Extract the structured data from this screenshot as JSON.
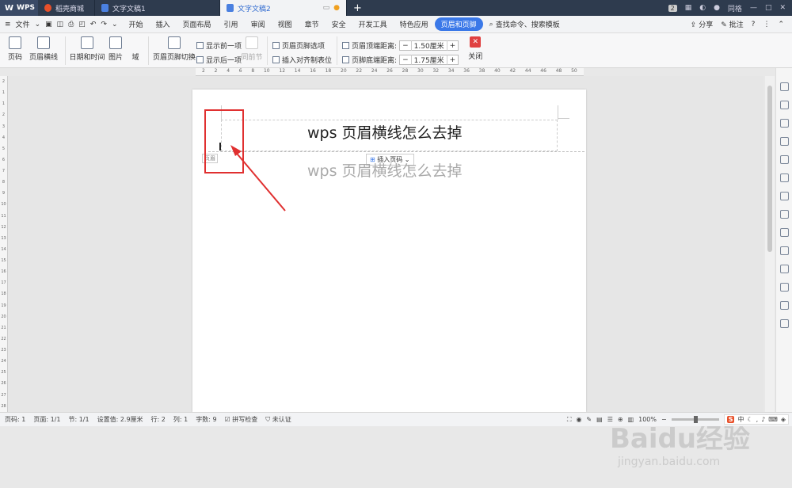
{
  "titlebar": {
    "app": "WPS",
    "tabs": [
      {
        "label": "稻壳商城"
      },
      {
        "label": "文字文稿1"
      },
      {
        "label": "文字文稿2"
      }
    ],
    "badge": "2",
    "user": "同格"
  },
  "menubar": {
    "file": "文件",
    "items": [
      "开始",
      "插入",
      "页面布局",
      "引用",
      "审阅",
      "视图",
      "章节",
      "安全",
      "开发工具",
      "特色应用"
    ],
    "active": "页眉和页脚",
    "search": "查找命令、搜索模板",
    "share": "分享",
    "comment": "批注"
  },
  "ribbon": {
    "page_number": "页码",
    "header_line": "页眉横线",
    "date_time": "日期和时间",
    "picture": "图片",
    "field": "域",
    "switch": "页眉页脚切换",
    "show_prev": "显示前一项",
    "show_next": "显示后一项",
    "same_prev": "同前节",
    "hf_options": "页眉页脚选项",
    "insert_align_tab": "插入对齐制表位",
    "header_top_label": "页眉顶端距离:",
    "header_top_value": "1.50厘米",
    "footer_bottom_label": "页脚底端距离:",
    "footer_bottom_value": "1.75厘米",
    "close": "关闭"
  },
  "ruler": {
    "h_ticks": [
      "2",
      "2",
      "4",
      "6",
      "8",
      "10",
      "12",
      "14",
      "16",
      "18",
      "20",
      "22",
      "24",
      "26",
      "28",
      "30",
      "32",
      "34",
      "36",
      "38",
      "40",
      "42",
      "44",
      "46",
      "48",
      "50"
    ],
    "v_ticks": [
      "2",
      "1",
      "1",
      "2",
      "3",
      "4",
      "5",
      "6",
      "7",
      "8",
      "9",
      "10",
      "11",
      "12",
      "13",
      "14",
      "15",
      "16",
      "17",
      "18",
      "19",
      "20",
      "21",
      "22",
      "23",
      "24",
      "25",
      "26",
      "27",
      "28"
    ]
  },
  "document": {
    "header_text": "wps 页眉横线怎么去掉",
    "body_text": "wps 页眉横线怎么去掉",
    "header_label": "页眉",
    "insert_page_number": "插入页码"
  },
  "statusbar": {
    "page_no": "页码: 1",
    "pages": "页面: 1/1",
    "section": "节: 1/1",
    "setting": "设置值: 2.9厘米",
    "row": "行: 2",
    "col": "列: 1",
    "words": "字数: 9",
    "spell": "拼写检查",
    "cert": "未认证",
    "zoom": "100%",
    "ime_lang": "中"
  },
  "watermark": {
    "brand": "Baidu经验",
    "url": "jingyan.baidu.com"
  },
  "colors": {
    "accent": "#3a78e8",
    "titlebar": "#2e3b4e",
    "highlight_red": "#e03030"
  }
}
